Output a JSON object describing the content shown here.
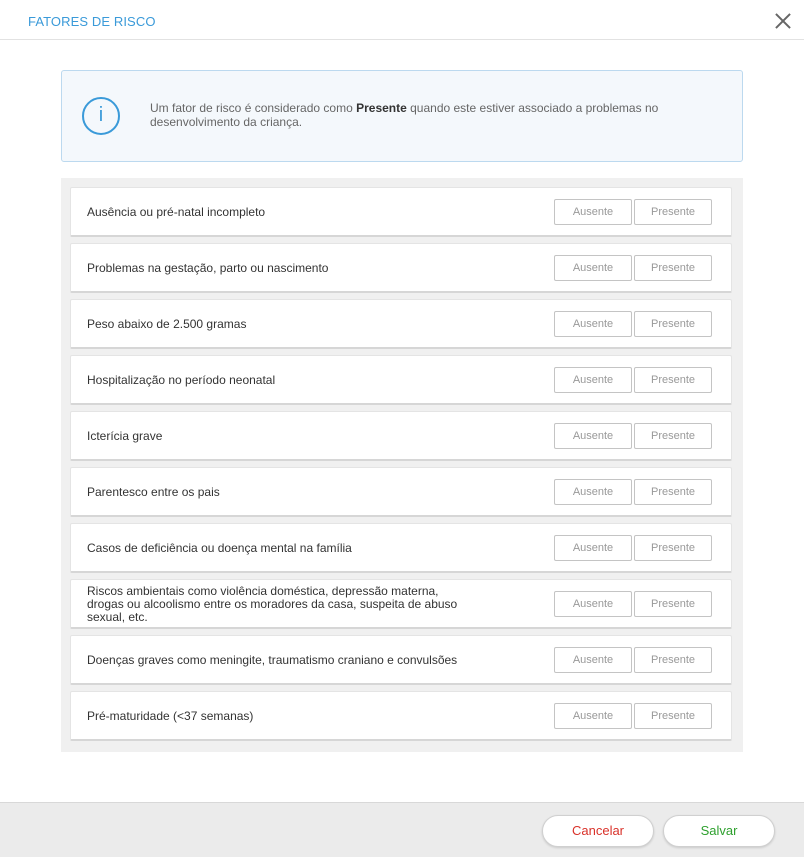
{
  "header": {
    "title": "FATORES DE RISCO",
    "close_icon": "close-icon"
  },
  "info": {
    "icon": "info-icon",
    "icon_glyph": "i",
    "text_before": "Um fator de risco é considerado como ",
    "text_bold": "Presente",
    "text_after": " quando este estiver associado a problemas no desenvolvimento da criança."
  },
  "options": {
    "ausente": "Ausente",
    "presente": "Presente"
  },
  "risk_factors": [
    "Ausência ou pré-natal incompleto",
    "Problemas na gestação, parto ou nascimento",
    "Peso abaixo de 2.500 gramas",
    "Hospitalização no período neonatal",
    "Icterícia grave",
    "Parentesco entre os pais",
    "Casos de deficiência ou doença mental na família",
    "Riscos ambientais como violência doméstica, depressão materna, drogas ou alcoolismo entre os moradores da casa, suspeita de abuso sexual, etc.",
    "Doenças graves como meningite, traumatismo craniano e convulsões",
    "Pré-maturidade (<37 semanas)"
  ],
  "footer": {
    "cancel_label": "Cancelar",
    "save_label": "Salvar"
  },
  "colors": {
    "accent": "#3a9ad9",
    "cancel": "#d9322a",
    "save": "#2ea02e"
  }
}
